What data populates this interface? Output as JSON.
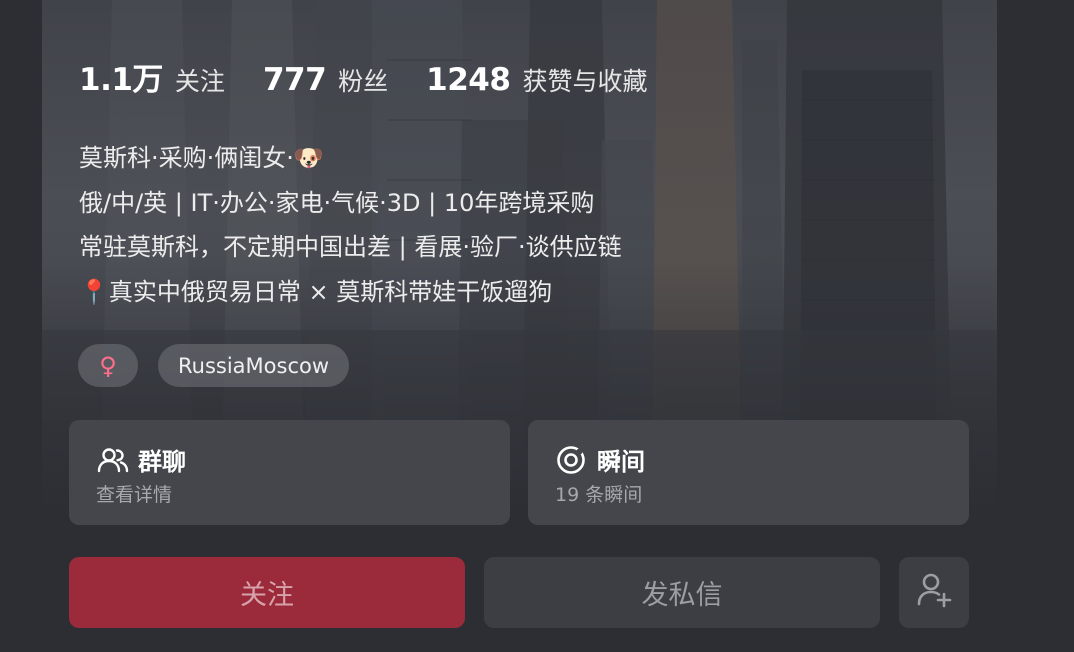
{
  "stats": {
    "following": {
      "value": "1.1万",
      "label": "关注"
    },
    "followers": {
      "value": "777",
      "label": "粉丝"
    },
    "likes": {
      "value": "1248",
      "label": "获赞与收藏"
    }
  },
  "bio": {
    "line1": "莫斯科·采购·俩闺女·🐶",
    "line2": "俄/中/英 | IT·办公·家电·气候·3D | 10年跨境采购",
    "line3": "常驻莫斯科，不定期中国出差 | 看展·验厂·谈供应链",
    "line4": "📍真实中俄贸易日常 × 莫斯科带娃干饭遛狗"
  },
  "tags": {
    "gender_symbol": "♀",
    "location": "RussiaMoscow"
  },
  "cards": {
    "group_chat": {
      "title": "群聊",
      "subtitle": "查看详情",
      "icon": "group-chat-icon"
    },
    "moments": {
      "title": "瞬间",
      "subtitle": "19 条瞬间",
      "icon": "moments-icon"
    }
  },
  "actions": {
    "follow_label": "关注",
    "message_label": "发私信",
    "add_friend_icon": "add-friend-icon"
  },
  "colors": {
    "follow_button": "#9b2a3b",
    "gender_female": "#ff6f8c",
    "card_background": "#44464c"
  }
}
